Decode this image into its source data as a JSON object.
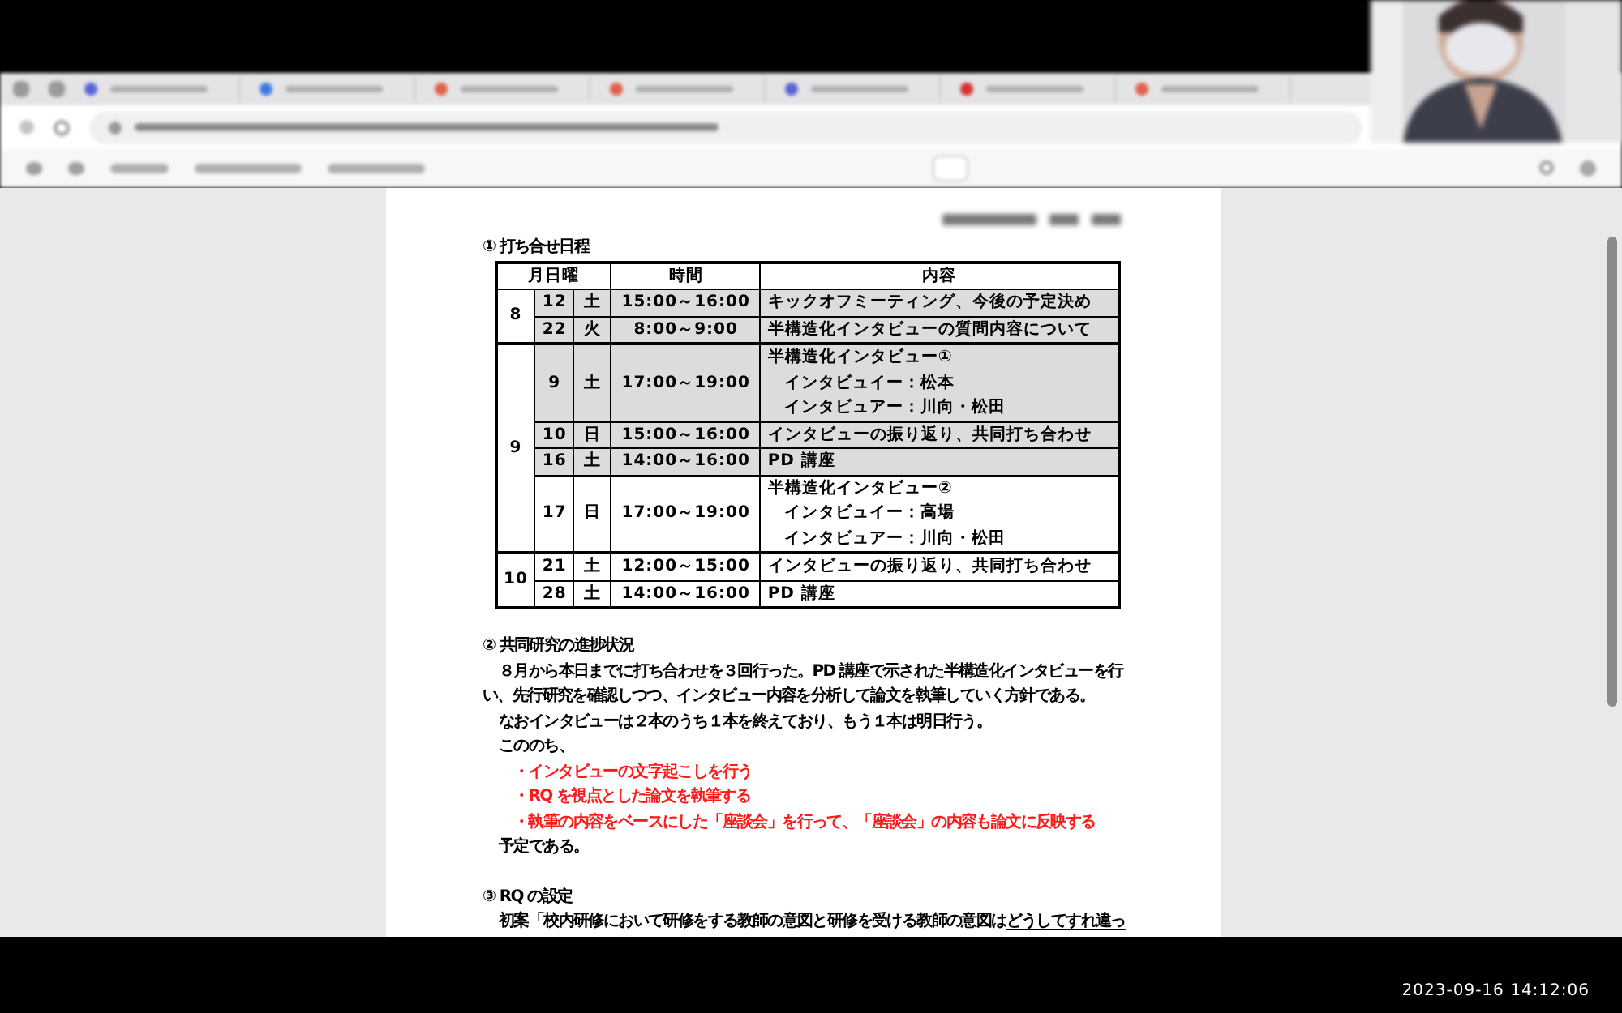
{
  "browser_tabs": [
    {
      "color": "#5b63d3"
    },
    {
      "color": "#3b7be0"
    },
    {
      "color": "#e0604a"
    },
    {
      "color": "#e0604a"
    },
    {
      "color": "#5b63d3"
    },
    {
      "color": "#d83030"
    },
    {
      "color": "#e0604a"
    }
  ],
  "document": {
    "section1_title": "① 打ち合せ日程",
    "schedule": {
      "columns": [
        "月日曜",
        "時間",
        "内容"
      ],
      "groups": [
        {
          "month": "8",
          "rows": [
            {
              "day": "12",
              "weekday": "土",
              "time": "15:00～16:00",
              "content": [
                "キックオフミーティング、今後の予定決め"
              ],
              "shaded": true
            },
            {
              "day": "22",
              "weekday": "火",
              "time": "8:00～9:00",
              "content": [
                "半構造化インタビューの質問内容について"
              ],
              "shaded": true
            }
          ]
        },
        {
          "month": "9",
          "rows": [
            {
              "day": "9",
              "weekday": "土",
              "time": "17:00～19:00",
              "content": [
                "半構造化インタビュー①",
                "インタビュイー：松本",
                "インタビュアー：川向・松田"
              ],
              "shaded": true
            },
            {
              "day": "10",
              "weekday": "日",
              "time": "15:00～16:00",
              "content": [
                "インタビューの振り返り、共同打ち合わせ"
              ],
              "shaded": true
            },
            {
              "day": "16",
              "weekday": "土",
              "time": "14:00～16:00",
              "content": [
                "PD 講座"
              ],
              "shaded": true
            },
            {
              "day": "17",
              "weekday": "日",
              "time": "17:00～19:00",
              "content": [
                "半構造化インタビュー②",
                "インタビュイー：高場",
                "インタビュアー：川向・松田"
              ],
              "shaded": false
            }
          ]
        },
        {
          "month": "10",
          "rows": [
            {
              "day": "21",
              "weekday": "土",
              "time": "12:00～15:00",
              "content": [
                "インタビューの振り返り、共同打ち合わせ"
              ],
              "shaded": false
            },
            {
              "day": "28",
              "weekday": "土",
              "time": "14:00～16:00",
              "content": [
                "PD 講座"
              ],
              "shaded": false
            }
          ]
        }
      ]
    },
    "section2_title": "② 共同研究の進捗状況",
    "section2_blocks": [
      {
        "kind": "paragraph",
        "text": "８月から本日までに打ち合わせを３回行った。PD 講座で示された半構造化インタビューを行い、先行研究を確認しつつ、インタビュー内容を分析して論文を執筆していく方針である。"
      },
      {
        "kind": "paragraph",
        "text": "なおインタビューは２本のうち１本を終えており、もう１本は明日行う。"
      },
      {
        "kind": "paragraph",
        "text": "こののち、"
      },
      {
        "kind": "bullet",
        "text": "・インタビューの文字起こしを行う",
        "color": "#ff1a1a"
      },
      {
        "kind": "bullet",
        "text": "・RQ を視点とした論文を執筆する",
        "color": "#ff1a1a"
      },
      {
        "kind": "bullet",
        "text": "・執筆の内容をベースにした「座談会」を行って、「座談会」の内容も論文に反映する",
        "color": "#ff1a1a"
      },
      {
        "kind": "paragraph",
        "text": "予定である。"
      }
    ],
    "section3_title": "③ RQ の設定",
    "section3_draft": {
      "text": "初案「校内研修において研修をする教師の意図と研修を受ける教師の意図は",
      "underlined": "どうしてすれ違っ"
    }
  },
  "timestamp": "2023-09-16 14:12:06"
}
